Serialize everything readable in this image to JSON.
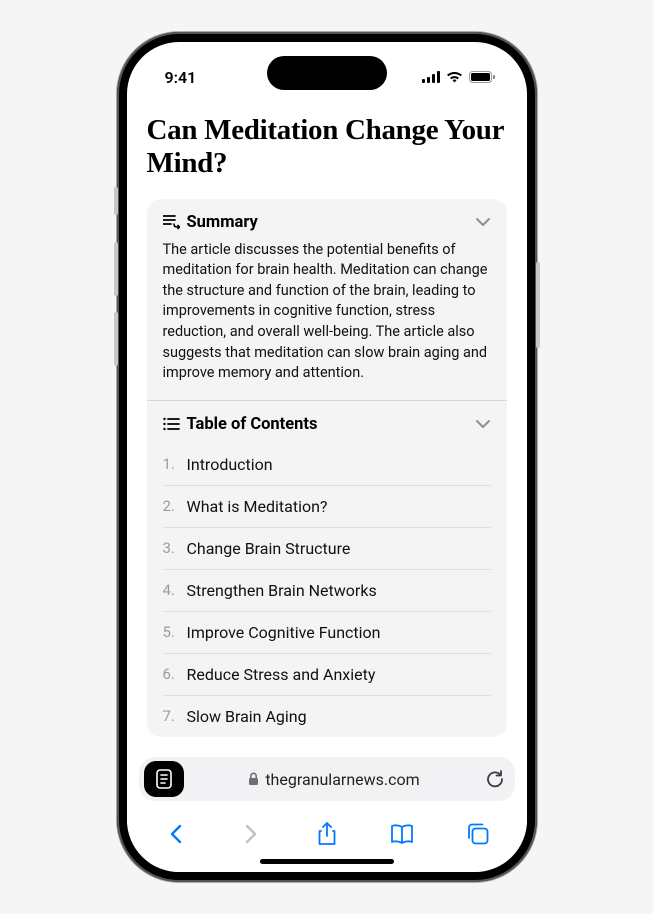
{
  "status": {
    "time": "9:41"
  },
  "article": {
    "title": "Can Meditation Change Your Mind?"
  },
  "summary": {
    "label": "Summary",
    "body": "The article discusses the potential benefits of meditation for brain health. Meditation can change the structure and function of the brain, leading to improvements in cognitive function, stress reduction, and overall well-being. The article also suggests that meditation can slow brain aging and improve memory and attention."
  },
  "toc": {
    "label": "Table of Contents",
    "items": [
      {
        "num": "1.",
        "label": "Introduction"
      },
      {
        "num": "2.",
        "label": "What is Meditation?"
      },
      {
        "num": "3.",
        "label": "Change Brain Structure"
      },
      {
        "num": "4.",
        "label": "Strengthen Brain Networks"
      },
      {
        "num": "5.",
        "label": "Improve Cognitive Function"
      },
      {
        "num": "6.",
        "label": "Reduce Stress and Anxiety"
      },
      {
        "num": "7.",
        "label": "Slow Brain Aging"
      }
    ]
  },
  "browser": {
    "url": "thegranularnews.com"
  }
}
